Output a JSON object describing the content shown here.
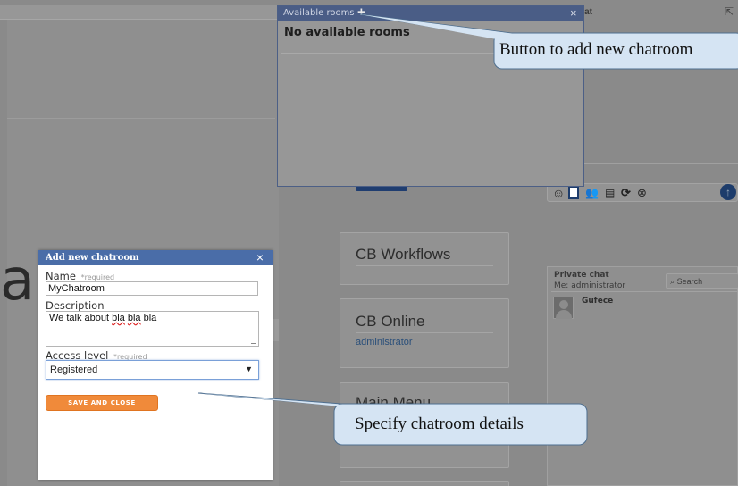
{
  "rooms_popup": {
    "title": "Available rooms",
    "add_icon": "+",
    "close_icon": "×",
    "empty_text": "No available rooms"
  },
  "chat": {
    "header": "hat",
    "popout_icon": "⇱",
    "toolbar_icons": [
      "smiley-icon",
      "sidebar-toggle-icon",
      "users-icon",
      "save-icon",
      "refresh-icon",
      "clear-icon"
    ],
    "send_icon": "upload-icon"
  },
  "widgets": {
    "workflows_title": "CB Workflows",
    "online_title": "CB Online",
    "online_user": "administrator",
    "main_menu_title": "Main Menu"
  },
  "private_chat": {
    "title": "Private chat",
    "me_label": "Me: administrator",
    "search_placeholder": "Search",
    "users": [
      {
        "name": "Gufece"
      }
    ]
  },
  "dialog": {
    "title": "Add new chatroom",
    "close_icon": "×",
    "name_label": "Name",
    "required_hint": "*required",
    "name_value": "MyChatroom",
    "description_label": "Description",
    "description_prefix": "We talk about ",
    "description_word1": "bla",
    "description_word2": "bla",
    "description_suffix": " bla",
    "access_label": "Access level",
    "access_value": "Registered",
    "save_button": "SAVE AND CLOSE"
  },
  "callouts": {
    "add_room": "Button to add new chatroom",
    "details": "Specify chatroom details"
  },
  "background": {
    "big_letter": "a"
  }
}
